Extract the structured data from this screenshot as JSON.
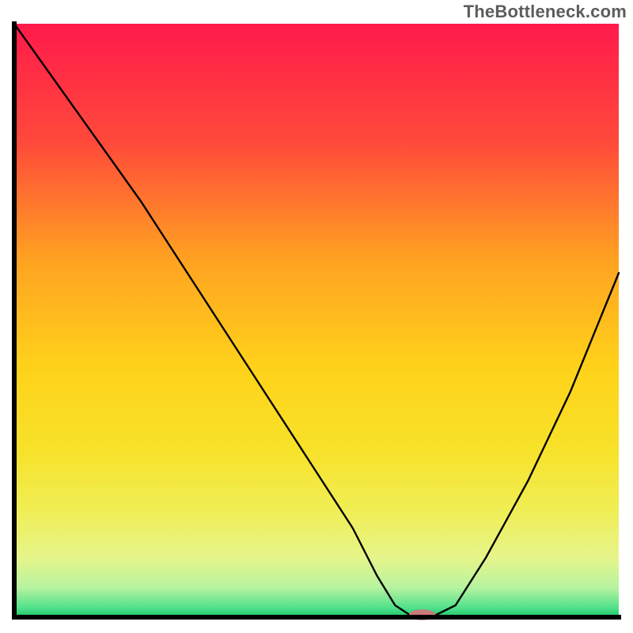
{
  "watermark": "TheBottleneck.com",
  "chart_data": {
    "type": "line",
    "title": "",
    "xlabel": "",
    "ylabel": "",
    "xlim": [
      0,
      100
    ],
    "ylim": [
      0,
      100
    ],
    "grid": false,
    "legend": false,
    "x": [
      0,
      7,
      14,
      21,
      28,
      35,
      42,
      49,
      56,
      60,
      63,
      66,
      69,
      73,
      78,
      85,
      92,
      100
    ],
    "values": [
      100,
      90,
      80,
      70,
      59,
      48,
      37,
      26,
      15,
      7,
      2,
      0,
      0,
      2,
      10,
      23,
      38,
      58
    ],
    "gradient_stops": [
      {
        "offset": 0.0,
        "color": "#ff1a4b"
      },
      {
        "offset": 0.2,
        "color": "#ff4a3a"
      },
      {
        "offset": 0.4,
        "color": "#ffa321"
      },
      {
        "offset": 0.58,
        "color": "#ffd21a"
      },
      {
        "offset": 0.72,
        "color": "#f7e22a"
      },
      {
        "offset": 0.82,
        "color": "#f0ee55"
      },
      {
        "offset": 0.9,
        "color": "#e6f58a"
      },
      {
        "offset": 0.95,
        "color": "#b7f3a0"
      },
      {
        "offset": 0.985,
        "color": "#4fe08a"
      },
      {
        "offset": 1.0,
        "color": "#18c465"
      }
    ],
    "marker": {
      "x": 67.5,
      "y": 0,
      "rx": 2.2,
      "ry": 0.9,
      "color": "#c97a7a"
    },
    "axis_color": "#000000",
    "line_color": "#000000",
    "line_width": 2.4
  }
}
